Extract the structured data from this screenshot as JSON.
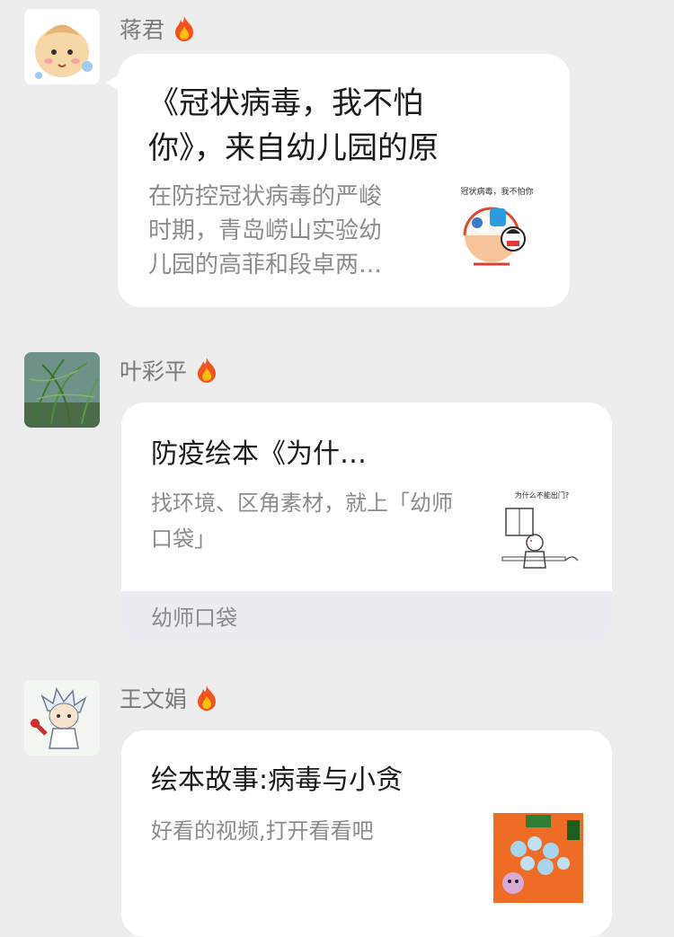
{
  "messages": [
    {
      "sender": "蒋君",
      "title_line1": "《冠状病毒，我不怕",
      "title_line2": "你》，来自幼儿园的原",
      "desc_line1": "在防控冠状病毒的严峻",
      "desc_line2": "时期，青岛崂山实验幼",
      "desc_line3": "儿园的高菲和段卓两…",
      "thumb_caption": "冠状病毒，我不怕你"
    },
    {
      "sender": "叶彩平",
      "title": "防疫绘本《为什…",
      "desc_line1": "找环境、区角素材，就上「幼师",
      "desc_line2": "口袋」",
      "footer": "幼师口袋",
      "thumb_caption": "为什么不能出门?"
    },
    {
      "sender": "王文娟",
      "title": "绘本故事:病毒与小贪",
      "desc": "好看的视频,打开看看吧"
    }
  ],
  "colors": {
    "background": "#ededed",
    "card": "#ffffff",
    "footer_bg": "#ebebf1",
    "title_text": "#1b1b1b",
    "desc_text": "#8c8c8c",
    "fire_outer": "#f4511e",
    "fire_inner": "#ffc107"
  }
}
